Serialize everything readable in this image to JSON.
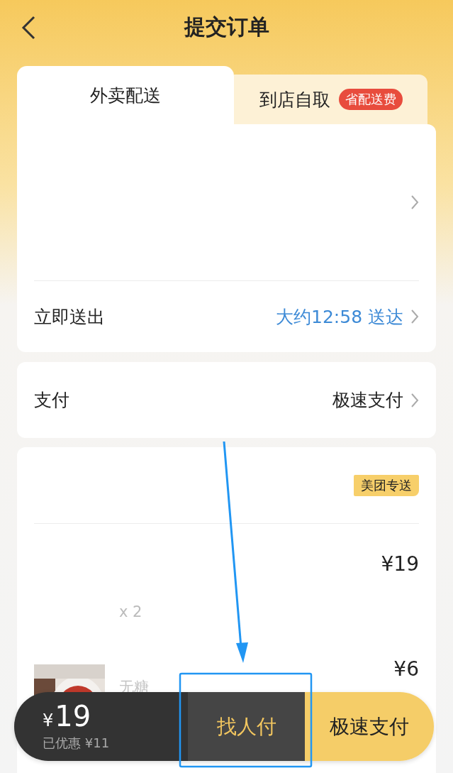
{
  "header": {
    "title": "提交订单"
  },
  "delivery_tabs": [
    {
      "label": "外卖配送",
      "selected": true
    },
    {
      "label": "到店自取",
      "selected": false,
      "badge": "省配送费"
    }
  ],
  "delivery_time": {
    "label": "立即送出",
    "value": "大约12:58 送达"
  },
  "payment": {
    "label": "支付",
    "value": "极速支付"
  },
  "order": {
    "delivery_tag": "美团专送",
    "items": [
      {
        "kind": "plain",
        "price": "¥19",
        "quantity": "x 2"
      },
      {
        "kind": "picture",
        "price": "¥6",
        "spec": "无糖"
      }
    ]
  },
  "bottom_bar": {
    "currency": "¥",
    "total": "19",
    "discount": "已优惠 ¥11",
    "actions": [
      {
        "kind": "secondary",
        "label": "找人付"
      },
      {
        "kind": "primary",
        "label": "极速支付"
      }
    ]
  }
}
